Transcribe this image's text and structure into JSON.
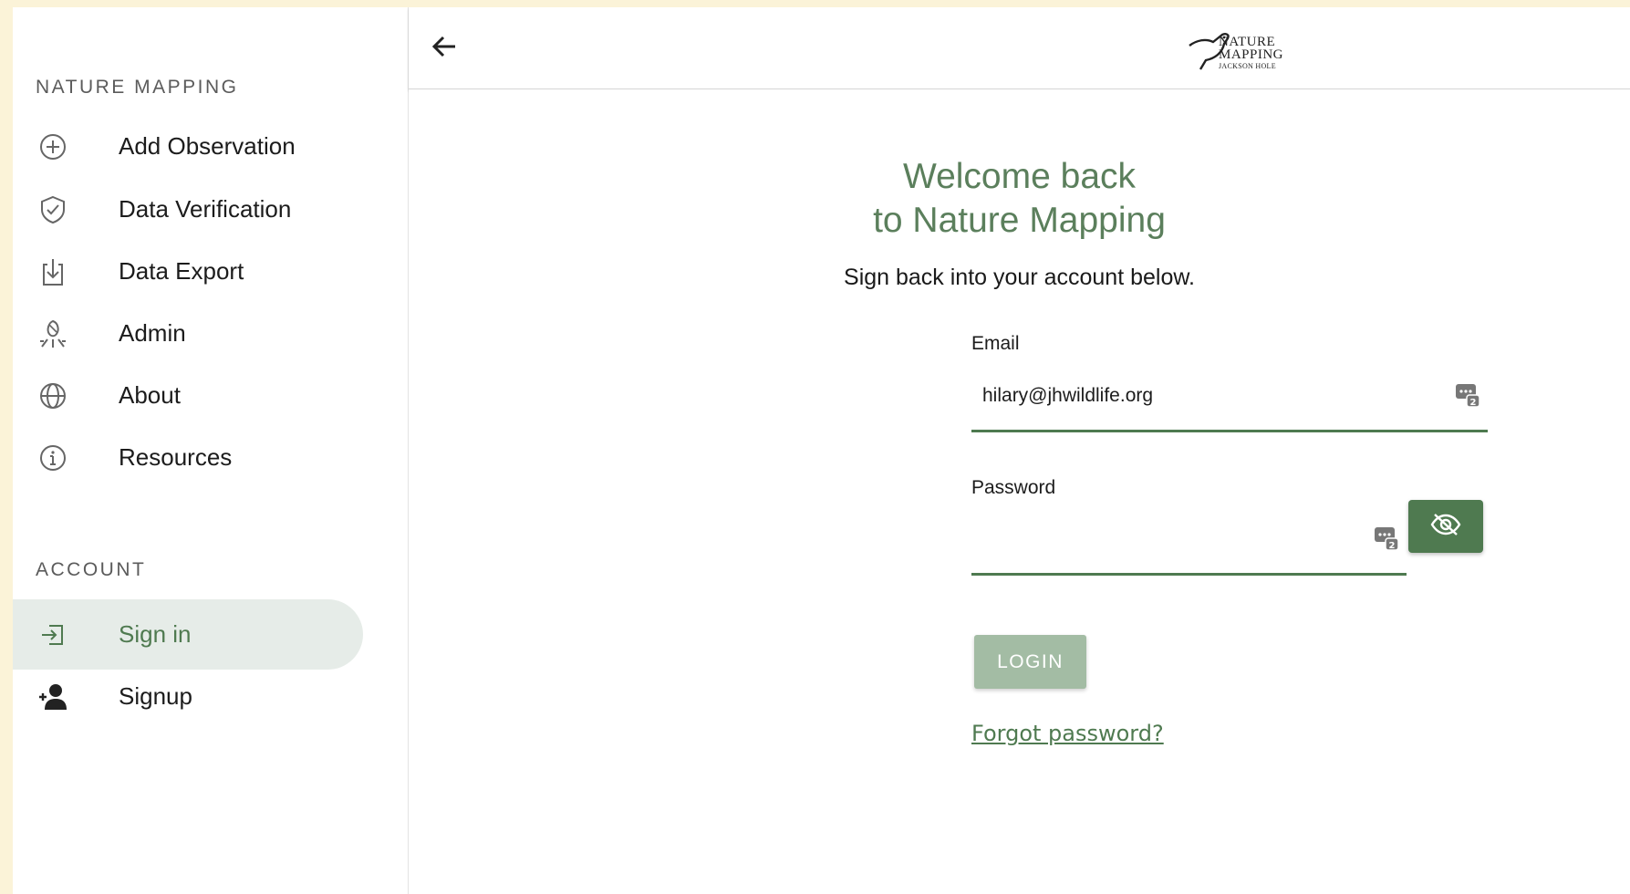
{
  "sidebar": {
    "section_title": "NATURE MAPPING",
    "items": [
      {
        "label": "Add Observation",
        "icon": "plus-circle-icon"
      },
      {
        "label": "Data Verification",
        "icon": "shield-check-icon"
      },
      {
        "label": "Data Export",
        "icon": "download-icon"
      },
      {
        "label": "Admin",
        "icon": "admin-icon"
      },
      {
        "label": "About",
        "icon": "globe-icon"
      },
      {
        "label": "Resources",
        "icon": "info-icon"
      }
    ],
    "account_title": "ACCOUNT",
    "account_items": [
      {
        "label": "Sign in",
        "icon": "sign-in-icon",
        "active": true
      },
      {
        "label": "Signup",
        "icon": "person-add-icon"
      }
    ]
  },
  "header": {
    "logo_line1": "NATURE",
    "logo_line2": "MAPPING",
    "logo_line3": "JACKSON HOLE"
  },
  "main": {
    "welcome_line1": "Welcome back",
    "welcome_line2": "to Nature Mapping",
    "subtitle": "Sign back into your account below.",
    "email_label": "Email",
    "email_value": "hilary@jhwildlife.org",
    "password_label": "Password",
    "password_value": "",
    "login_label": "LOGIN",
    "forgot_label": "Forgot password?"
  },
  "colors": {
    "accent": "#4f7a50",
    "login_disabled": "#a3bca4",
    "active_bg": "#e6ece8",
    "page_bg": "#fbf3d8"
  }
}
